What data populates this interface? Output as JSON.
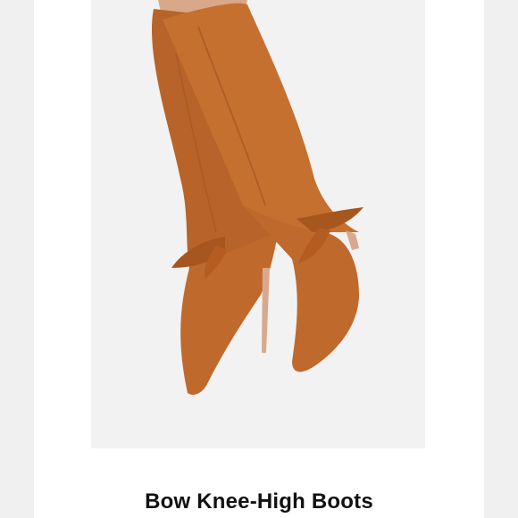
{
  "product": {
    "title": "Bow Knee-High Boots",
    "image_description_icon": "boot-photo",
    "colors": {
      "suede": "#c0692c",
      "suede_shadow": "#9e5220",
      "background": "#f2f2f2"
    }
  }
}
